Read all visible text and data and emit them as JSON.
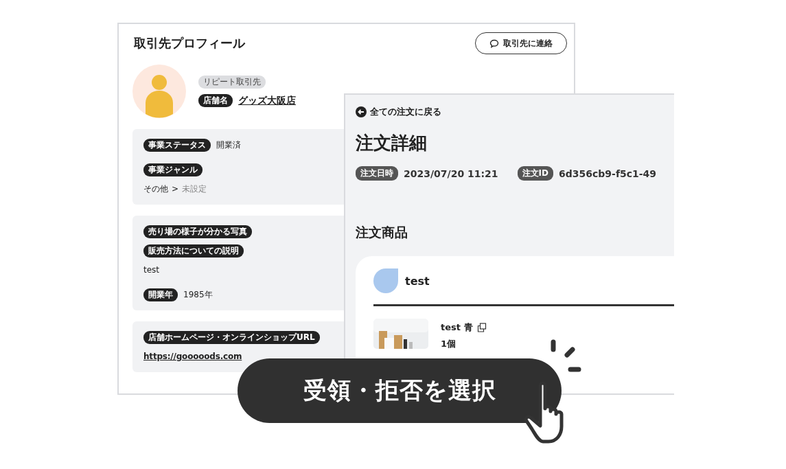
{
  "profile": {
    "title": "取引先プロフィール",
    "contact_button": "取引先に連絡",
    "tag": "リピート取引先",
    "shop_label": "店舗名",
    "shop_name": "グッズ大阪店",
    "cards": [
      {
        "items": [
          {
            "kind": "field",
            "label": "事業ステータス",
            "value": "開業済"
          },
          {
            "kind": "label",
            "label": "事業ジャンル"
          },
          {
            "kind": "path",
            "parts": [
              {
                "text": "その他",
                "muted": false
              },
              {
                "text": ">",
                "muted": false
              },
              {
                "text": "未設定",
                "muted": true
              }
            ]
          }
        ]
      },
      {
        "items": [
          {
            "kind": "label",
            "label": "売り場の様子が分かる写真"
          },
          {
            "kind": "label",
            "label": "販売方法についての説明"
          },
          {
            "kind": "text",
            "value": "test"
          },
          {
            "kind": "field",
            "label": "開業年",
            "value": "1985年"
          }
        ]
      },
      {
        "items": [
          {
            "kind": "label",
            "label": "店舗ホームページ・オンラインショップURL"
          },
          {
            "kind": "link",
            "value": "https://gooooods.com"
          }
        ]
      }
    ]
  },
  "order": {
    "back_link": "全ての注文に戻る",
    "title": "注文詳細",
    "meta": [
      {
        "label": "注文日時",
        "value": "2023/07/20 11:21"
      },
      {
        "label": "注文ID",
        "value": "6d356cb9-f5c1-49"
      }
    ],
    "section": "注文商品",
    "shop": "test",
    "items": [
      {
        "name": "test 青",
        "quantity": "1個"
      }
    ]
  },
  "action_button": "受領・拒否を選択"
}
